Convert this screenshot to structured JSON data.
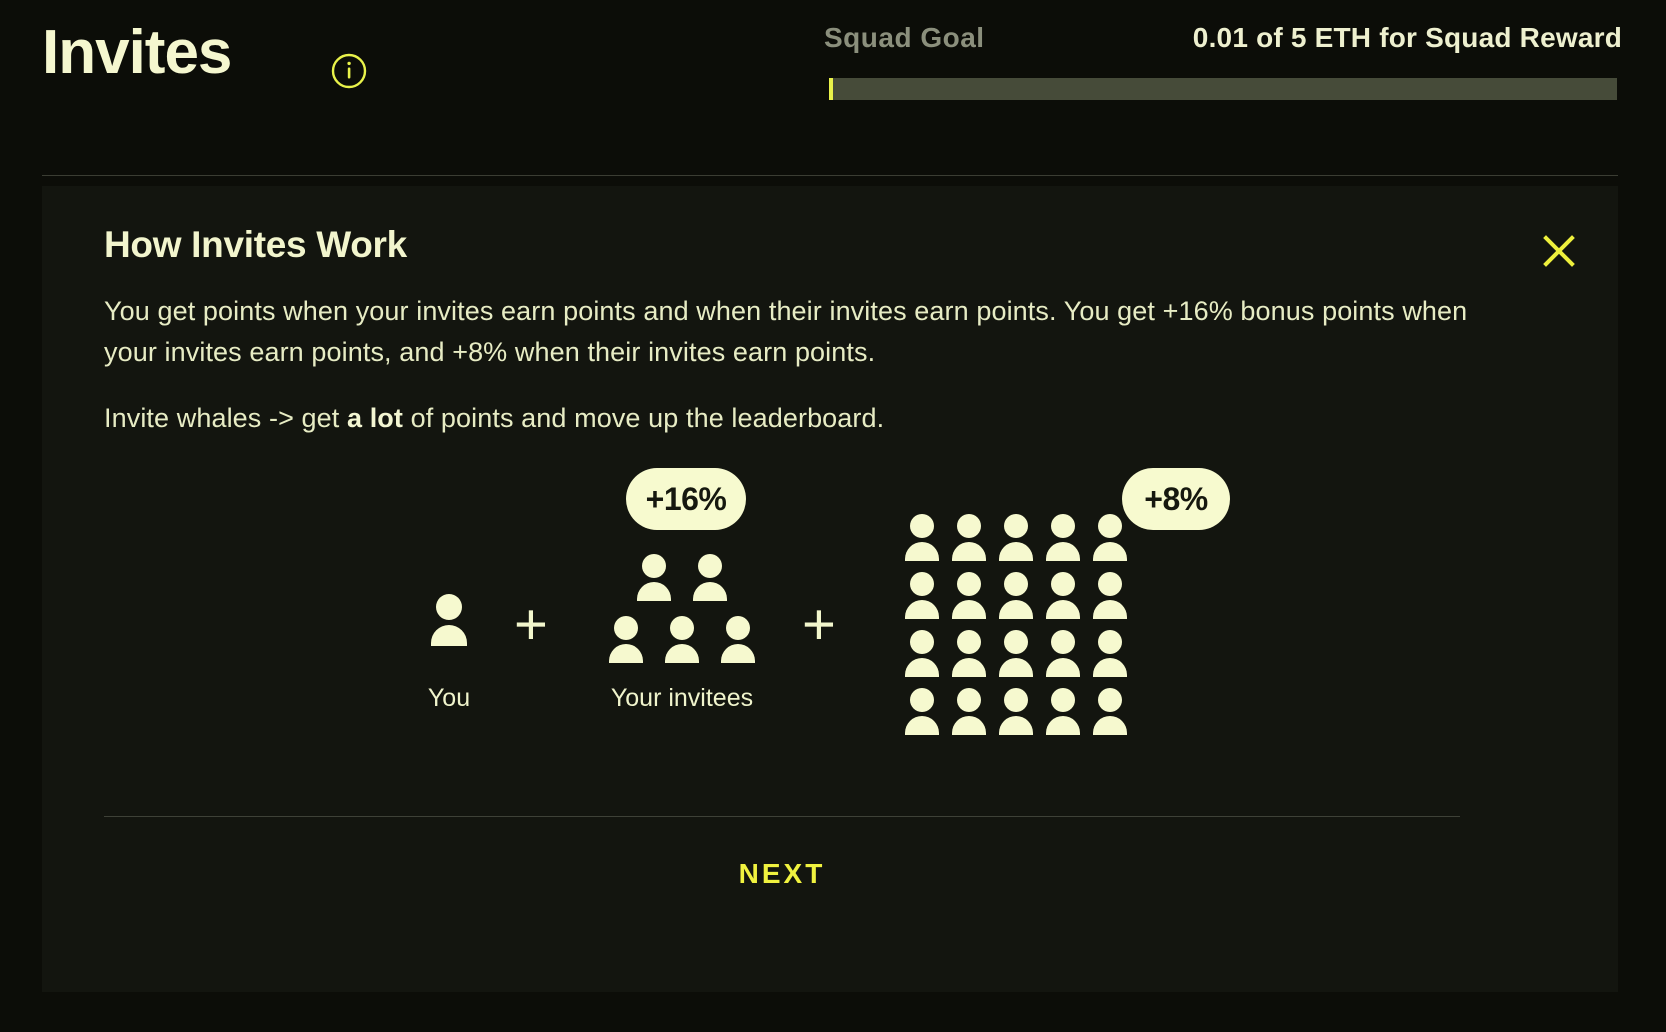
{
  "header": {
    "title": "Invites",
    "info_icon": "info-circle-icon",
    "squad_goal_label": "Squad Goal",
    "squad_goal_value": "0.01 of 5 ETH for Squad Reward",
    "progress": {
      "current": 0.01,
      "target": 5,
      "unit": "ETH",
      "percent": 0.5,
      "fill_color": "#e9f24a",
      "track_color": "#464b39"
    }
  },
  "card": {
    "title": "How Invites Work",
    "close_icon": "close-x-icon",
    "paragraph_1": "You get points when your invites earn points and when their invites earn points. You get +16% bonus points when your invites earn points, and +8% when their invites earn points.",
    "paragraph_2_pre": "Invite whales -> get ",
    "paragraph_2_bold": "a lot",
    "paragraph_2_post": " of points and move up the leaderboard.",
    "next_label": "NEXT"
  },
  "diagram": {
    "you_label": "You",
    "you_count": 1,
    "plus_1": "+",
    "invitees_label": "Your invitees",
    "invitees_badge": "+16%",
    "invitees_rows": [
      2,
      3
    ],
    "plus_2": "+",
    "second_degree_badge": "+8%",
    "second_degree_rows": 4,
    "second_degree_cols": 5,
    "person_icon": "person-icon"
  },
  "colors": {
    "background": "#0c0d08",
    "card_background": "#13150f",
    "cream": "#f6f9cf",
    "accent_yellow": "#e9f24a",
    "muted": "#8b8f7c"
  }
}
